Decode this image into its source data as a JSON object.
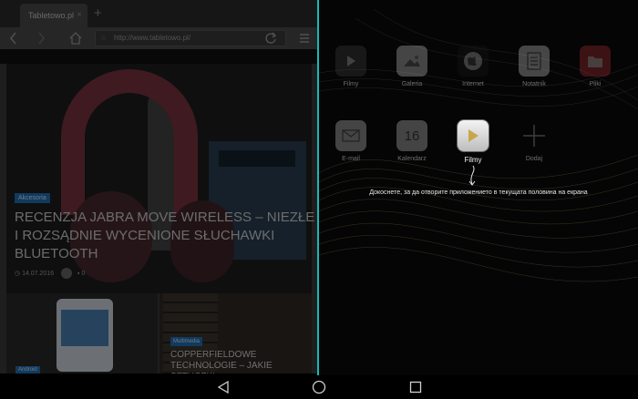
{
  "browser": {
    "tab_title": "Tabletowo.pl",
    "tab_close": "×",
    "new_tab": "+",
    "url": "http://www.tabletowo.pl/",
    "hero": {
      "category": "Akcesoria",
      "headline": "RECENZJA JABRA MOVE WIRELESS – NIEZŁE I ROZSĄDNIE WYCENIONE SŁUCHAWKI BLUETOOTH",
      "date": "14.07.2016",
      "comments": "0"
    },
    "card_left": {
      "category": "Android"
    },
    "card_right": {
      "category": "Multimedia",
      "title": "COPPERFIELDOWE TECHNOLOGIE – JAKIE SZTUCZKI"
    }
  },
  "split": {
    "divider_color": "#19b7b7",
    "hint": "Докоснете, за да отворите приложението в текущата половина на екрана",
    "apps_row1": [
      {
        "name": "Filmy",
        "icon": "play-icon",
        "color": "#4a4a4a"
      },
      {
        "name": "Galeria",
        "icon": "gallery-icon",
        "color": "#e9e9e9"
      },
      {
        "name": "Internet",
        "icon": "globe-icon",
        "color": "#1d1d1d"
      },
      {
        "name": "Notatnik",
        "icon": "notepad-icon",
        "color": "#efefef"
      },
      {
        "name": "Pliki",
        "icon": "files-icon",
        "color": "#c9343b"
      }
    ],
    "apps_row2": [
      {
        "name": "E-mail",
        "icon": "mail-icon",
        "color": "#e8e8e8"
      },
      {
        "name": "Kalendarz",
        "icon": "calendar-icon",
        "color": "#e8e8e8",
        "day": "16"
      },
      {
        "name": "Filmy",
        "icon": "play-icon",
        "color": "#ededed",
        "active": true
      },
      {
        "name": "Dodaj",
        "icon": "add-icon",
        "color": "transparent"
      }
    ]
  }
}
